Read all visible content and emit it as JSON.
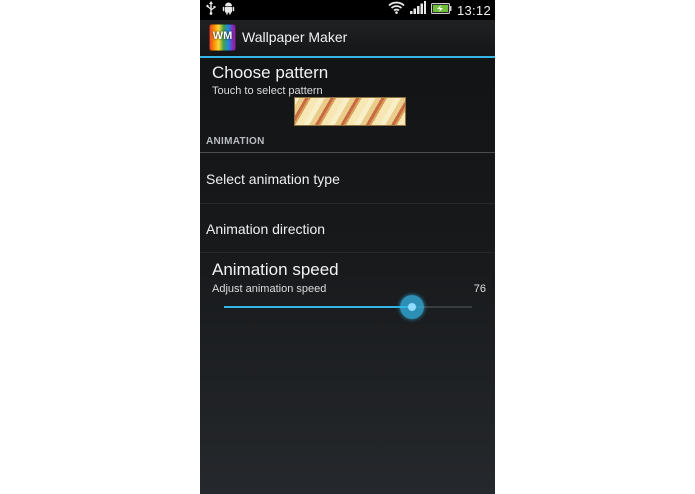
{
  "status_bar": {
    "time": "13:12",
    "icons": [
      "usb-icon",
      "android-debug-icon",
      "wifi-icon",
      "signal-icon",
      "battery-charging-icon"
    ]
  },
  "action_bar": {
    "title": "Wallpaper Maker",
    "icon_text": "WM"
  },
  "pattern": {
    "title": "Choose pattern",
    "summary": "Touch to select pattern"
  },
  "section": {
    "header": "ANIMATION"
  },
  "animation_type": {
    "label": "Select animation type"
  },
  "animation_direction": {
    "label": "Animation direction"
  },
  "animation_speed": {
    "title": "Animation speed",
    "summary": "Adjust animation speed",
    "value": 76,
    "value_label": "76",
    "max": 100
  },
  "colors": {
    "accent": "#33b5e5",
    "background": "#16181a",
    "text": "#f0f0f0"
  }
}
